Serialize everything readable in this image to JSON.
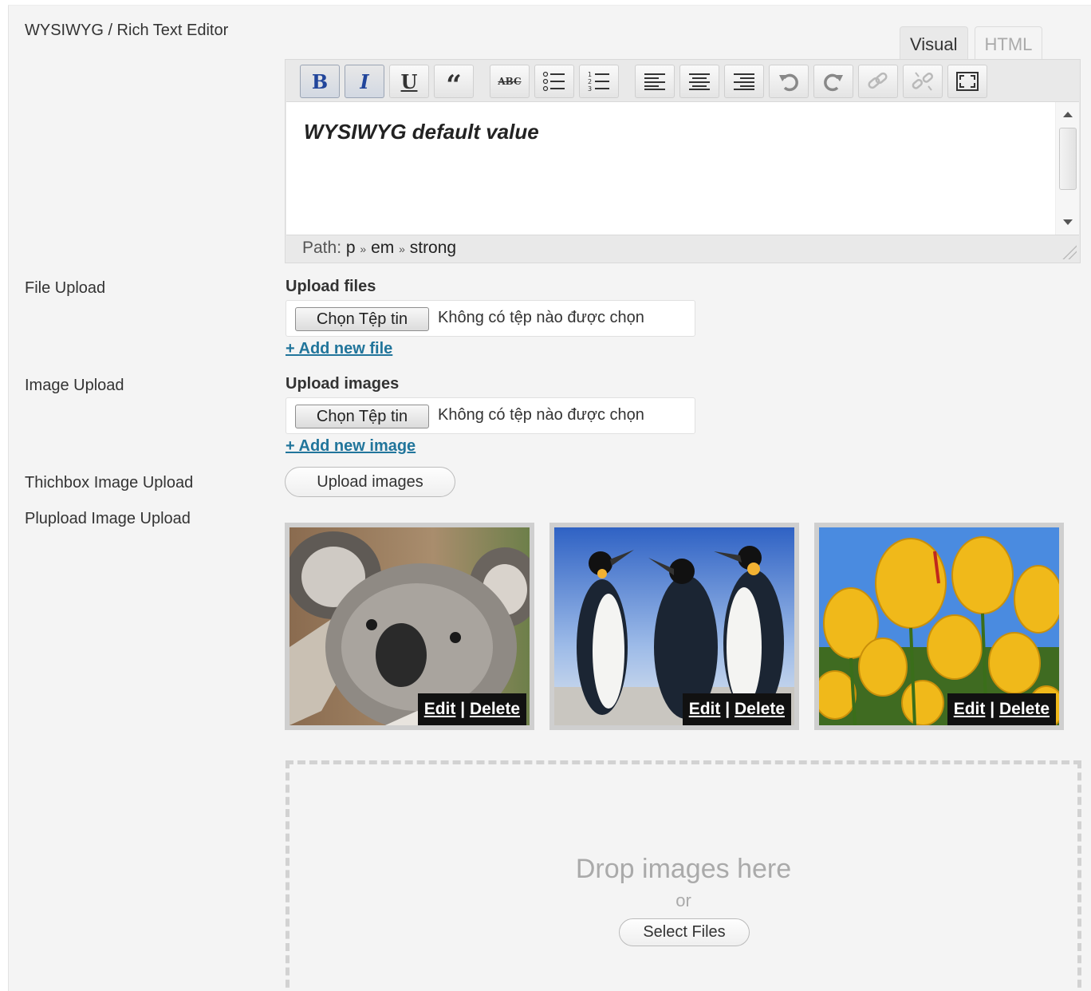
{
  "labels": {
    "wysiwyg": "WYSIWYG / Rich Text Editor",
    "file_upload": "File Upload",
    "image_upload": "Image Upload",
    "thickbox": "Thichbox Image Upload",
    "plupload": "Plupload Image Upload"
  },
  "editor": {
    "tabs": [
      "Visual",
      "HTML"
    ],
    "active_tab": "Visual",
    "toolbar": [
      {
        "name": "bold",
        "icon": "bold-icon",
        "glyph": "B"
      },
      {
        "name": "italic",
        "icon": "italic-icon",
        "glyph": "I"
      },
      {
        "name": "underline",
        "icon": "underline-icon",
        "glyph": "U"
      },
      {
        "name": "blockquote",
        "icon": "quote-icon",
        "glyph": "“"
      },
      {
        "name": "strikethrough",
        "icon": "strikethrough-icon",
        "glyph": "ABC"
      },
      {
        "name": "bullet-list",
        "icon": "bullet-list-icon"
      },
      {
        "name": "numbered-list",
        "icon": "numbered-list-icon"
      },
      {
        "name": "align-left",
        "icon": "align-left-icon"
      },
      {
        "name": "align-center",
        "icon": "align-center-icon"
      },
      {
        "name": "align-right",
        "icon": "align-right-icon"
      },
      {
        "name": "undo",
        "icon": "undo-icon"
      },
      {
        "name": "redo",
        "icon": "redo-icon"
      },
      {
        "name": "link",
        "icon": "link-icon"
      },
      {
        "name": "unlink",
        "icon": "unlink-icon"
      },
      {
        "name": "fullscreen",
        "icon": "fullscreen-icon"
      }
    ],
    "content": "WYSIWYG default value",
    "path_label": "Path:",
    "path": [
      "p",
      "em",
      "strong"
    ],
    "path_separator": "»"
  },
  "file_upload": {
    "title": "Upload files",
    "button": "Chọn Tệp tin",
    "status": "Không có tệp nào được chọn",
    "add_link": "+ Add new file"
  },
  "image_upload": {
    "title": "Upload images",
    "button": "Chọn Tệp tin",
    "status": "Không có tệp nào được chọn",
    "add_link": "+ Add new image"
  },
  "thickbox": {
    "button": "Upload images"
  },
  "plupload": {
    "images": [
      {
        "subject": "koala",
        "edit": "Edit",
        "sep": "|",
        "delete": "Delete"
      },
      {
        "subject": "penguins",
        "edit": "Edit",
        "sep": "|",
        "delete": "Delete"
      },
      {
        "subject": "tulips",
        "edit": "Edit",
        "sep": "|",
        "delete": "Delete"
      }
    ],
    "drop_text": "Drop images here",
    "or_text": "or",
    "select_button": "Select Files"
  }
}
